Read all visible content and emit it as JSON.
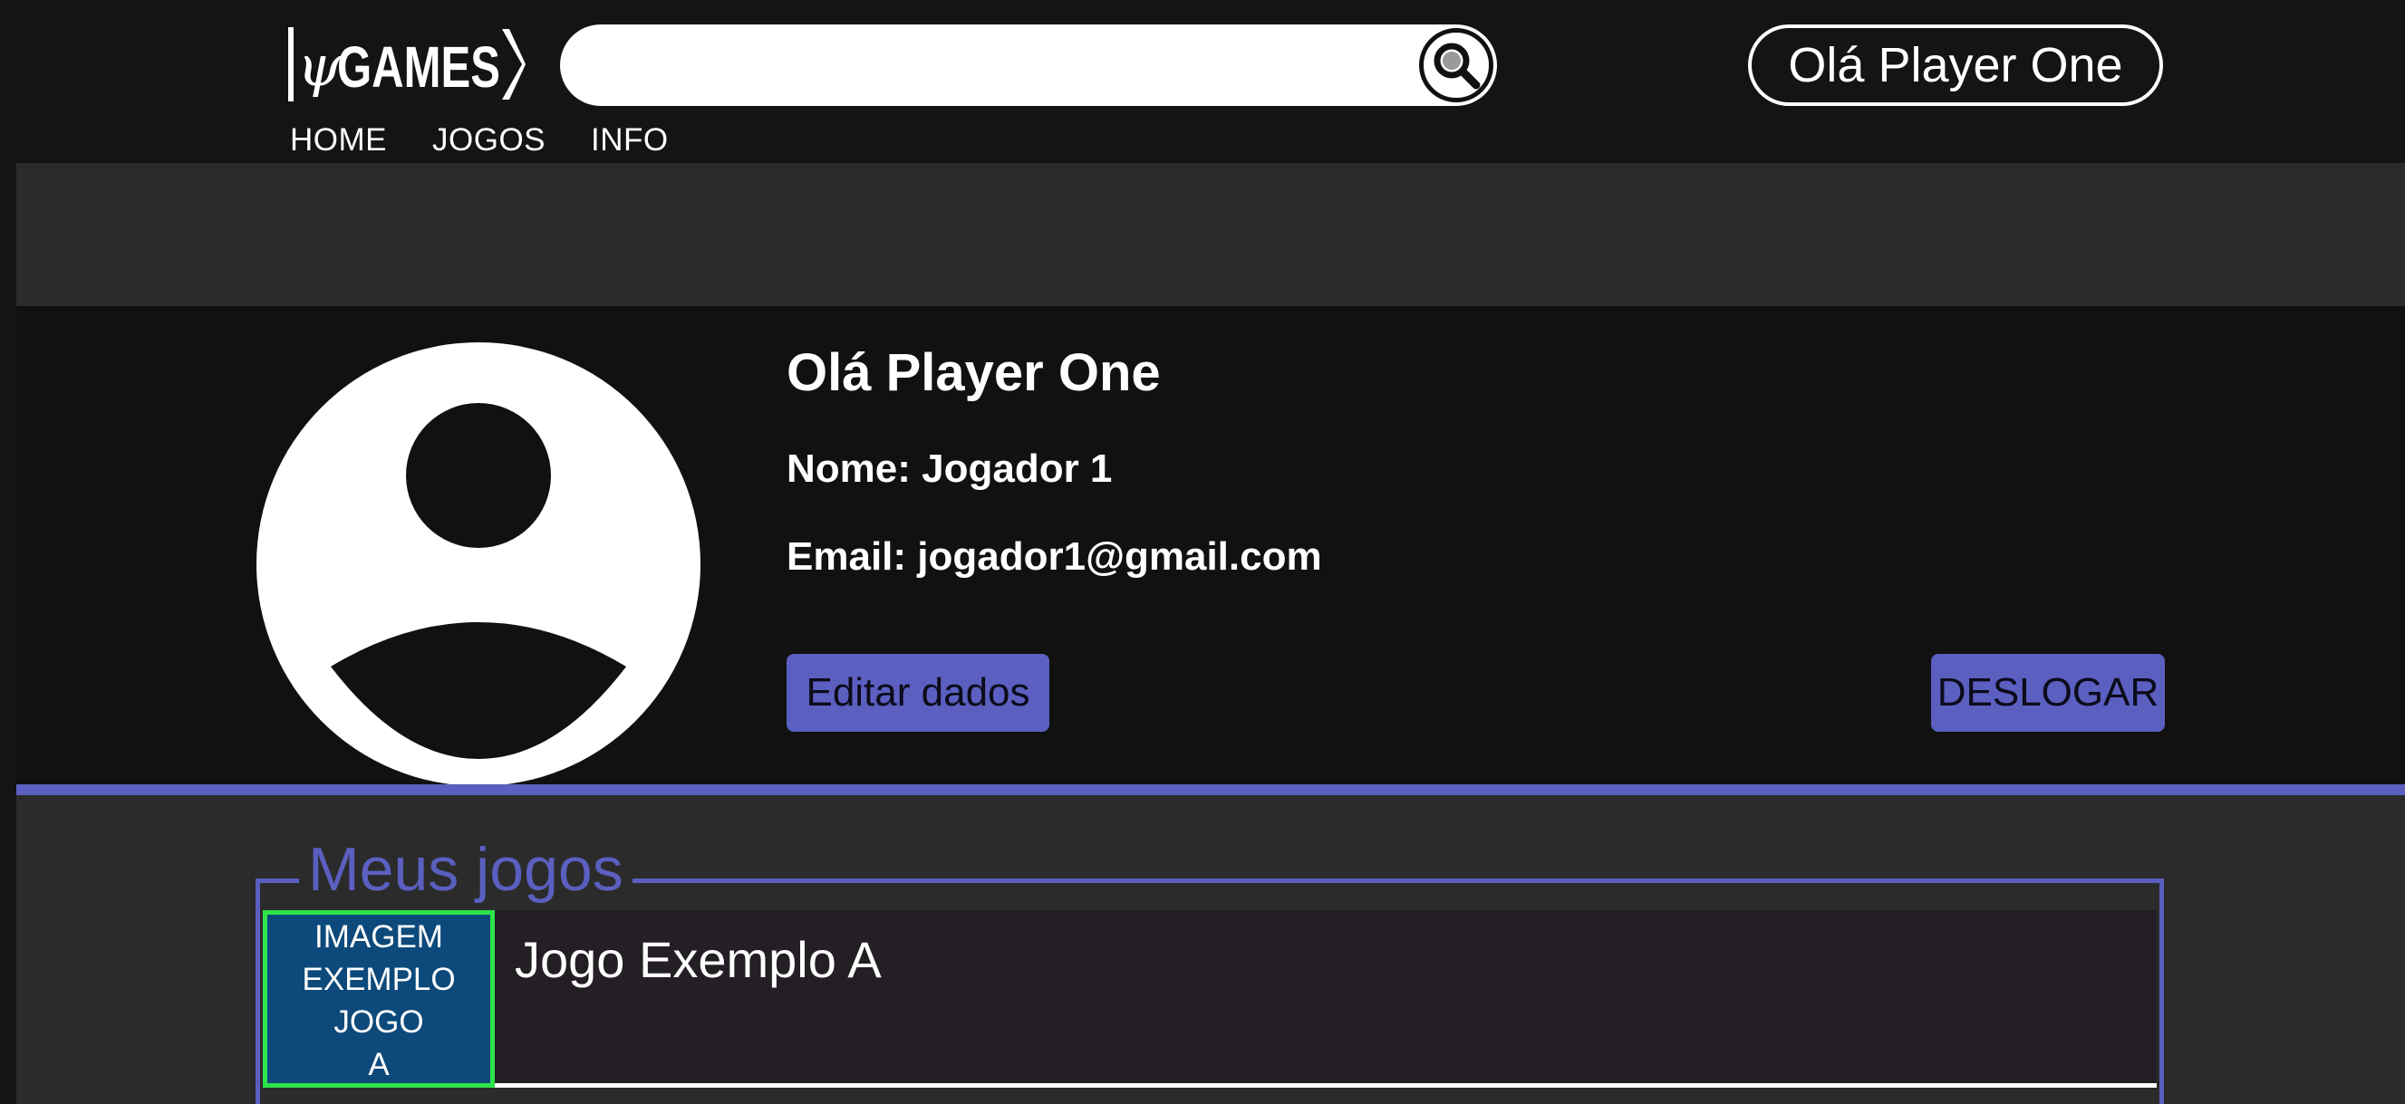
{
  "header": {
    "logo_text": "ψGAMES",
    "search": {
      "placeholder": "",
      "value": ""
    },
    "search_icon": "search-icon",
    "greeting": "Olá Player One",
    "nav": [
      "HOME",
      "JOGOS",
      "INFO"
    ]
  },
  "profile": {
    "avatar_icon": "user-avatar-icon",
    "title": "Olá Player One",
    "name_line": "Nome: Jogador 1",
    "email_line": "Email: jogador1@gmail.com",
    "edit_label": "Editar dados",
    "logout_label": "DESLOGAR"
  },
  "games": {
    "legend": "Meus jogos",
    "items": [
      {
        "thumb_lines": [
          "IMAGEM",
          "EXEMPLO",
          "JOGO",
          "A"
        ],
        "title": "Jogo Exemplo A"
      }
    ]
  },
  "colors": {
    "background": "#2b2b2b",
    "header": "#141414",
    "accent": "#5a5fc0",
    "thumb_bg": "#0d4a7b",
    "thumb_border": "#2ee34a"
  }
}
